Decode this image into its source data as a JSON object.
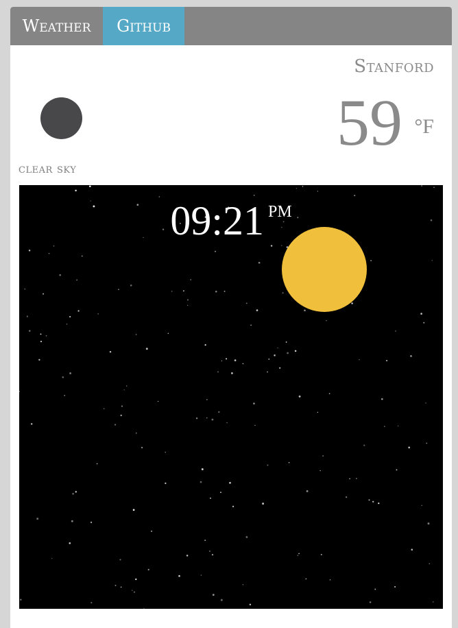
{
  "tabs": [
    {
      "label": "Weather"
    },
    {
      "label": "Github"
    }
  ],
  "colors": {
    "tab_bar": "#858585",
    "tab_active": "#55a8c6",
    "moon_icon": "#48484a",
    "sun": "#f0c03c",
    "sky": "#000000"
  },
  "weather": {
    "location": "Stanford",
    "temperature": "59",
    "unit": "°F",
    "condition": "clear sky",
    "condition_icon": "moon-icon"
  },
  "sky": {
    "time": "09:21",
    "ampm": "PM"
  }
}
